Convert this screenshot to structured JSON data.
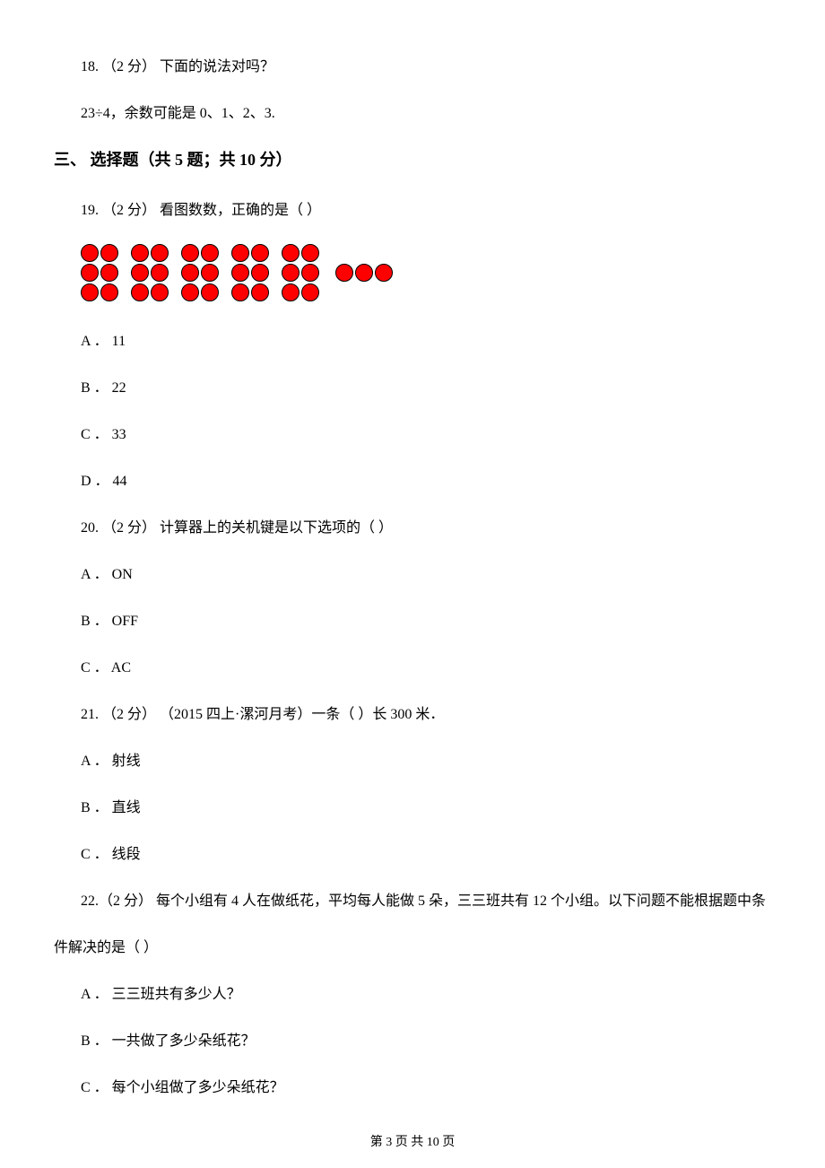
{
  "q18": {
    "header": "18. （2 分） 下面的说法对吗？",
    "detail": "23÷4，余数可能是 0、1、2、3."
  },
  "section3": {
    "title": "三、 选择题（共 5 题；共 10 分）"
  },
  "q19": {
    "header": "19. （2 分） 看图数数，正确的是（    ）",
    "optA": "A ． 11",
    "optB": "B ． 22",
    "optC": "C ． 33",
    "optD": "D ． 44"
  },
  "q20": {
    "header": "20. （2 分） 计算器上的关机键是以下选项的（    ）",
    "optA": "A ． ON",
    "optB": "B ． OFF",
    "optC": "C ． AC"
  },
  "q21": {
    "header": "21. （2 分） （2015 四上·漯河月考）一条（    ）长 300 米．",
    "optA": "A ． 射线",
    "optB": "B ． 直线",
    "optC": "C ． 线段"
  },
  "q22": {
    "line1": "22.（2 分） 每个小组有 4 人在做纸花，平均每人能做 5 朵，三三班共有 12 个小组。以下问题不能根据题中条",
    "line2": "件解决的是（    ）",
    "optA": "A ． 三三班共有多少人？",
    "optB": "B ． 一共做了多少朵纸花？",
    "optC": "C ． 每个小组做了多少朵纸花？"
  },
  "footer": "第 3 页 共 10 页"
}
